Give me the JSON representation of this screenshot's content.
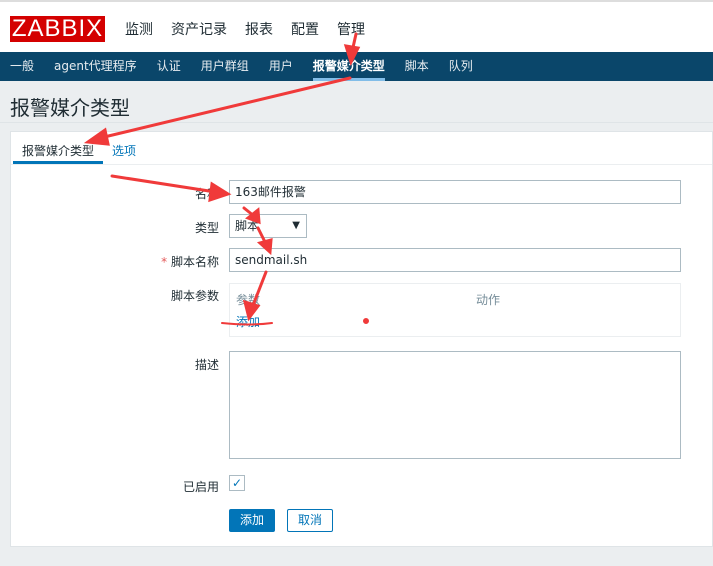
{
  "logo": "ZABBIX",
  "main_nav": [
    "监测",
    "资产记录",
    "报表",
    "配置",
    "管理"
  ],
  "sub_nav": [
    "一般",
    "agent代理程序",
    "认证",
    "用户群组",
    "用户",
    "报警媒介类型",
    "脚本",
    "队列"
  ],
  "page_title": "报警媒介类型",
  "tabs": [
    "报警媒介类型",
    "选项"
  ],
  "form": {
    "name_label": "名称",
    "name_value": "163邮件报警",
    "type_label": "类型",
    "type_value": "脚本",
    "script_label": "脚本名称",
    "script_value": "sendmail.sh",
    "required_mark": "*",
    "params_label": "脚本参数",
    "params_col1": "参数",
    "params_col2": "动作",
    "params_add": "添加",
    "desc_label": "描述",
    "desc_value": "",
    "enabled_label": "已启用",
    "enabled": true,
    "add_button": "添加",
    "cancel_button": "取消"
  },
  "colors": {
    "brand": "#d40000",
    "nav": "#0a466a",
    "accent": "#0275b8"
  }
}
